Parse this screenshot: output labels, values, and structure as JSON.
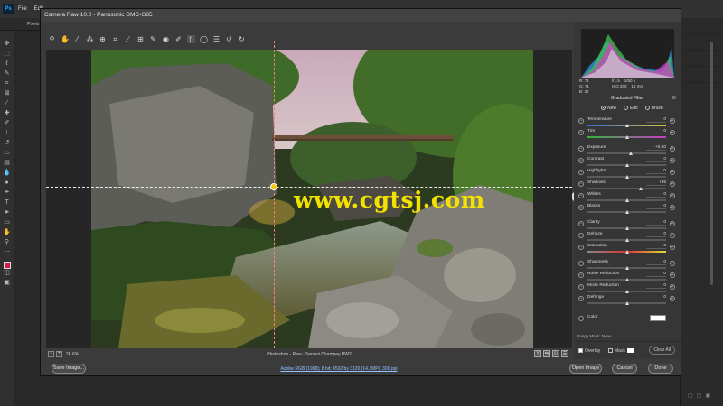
{
  "ps": {
    "logo": "Ps",
    "menu": [
      "File",
      "Edit"
    ],
    "option_text": "Pixels"
  },
  "dialog": {
    "title": "Camera Raw 10.0  -  Panasonic DMC-G85",
    "zoom_level": "26.6%",
    "filename": "Photoshop - Raw - Sennut Champey.RW2",
    "workflow_link": "Adobe RGB (1998); 8 bit; 4592 by 3120 (14.3MP); 300 ppi",
    "buttons": {
      "save_image": "Save Image...",
      "open_image": "Open Image",
      "cancel": "Cancel",
      "done": "Done"
    }
  },
  "watermark": "www.cgtsj.com",
  "readout": {
    "r": "R:    71",
    "g": "G:    71",
    "b": "B:    32",
    "aperture": "f/1.5",
    "shutter": "1/50 s",
    "iso": "ISO 200",
    "focal": "12 mm"
  },
  "panel": {
    "title": "Graduated Filter",
    "modes": [
      "New",
      "Edit",
      "Brush"
    ],
    "selected_mode": "New",
    "sliders": [
      {
        "label": "Temperature",
        "value": "0",
        "position": 0.5,
        "track": "temp"
      },
      {
        "label": "Tint",
        "value": "0",
        "position": 0.5,
        "track": "tint"
      },
      {
        "label": "Exposure",
        "value": "+0.30",
        "position": 0.55,
        "track": "plain",
        "gap": true
      },
      {
        "label": "Contrast",
        "value": "0",
        "position": 0.5,
        "track": "plain"
      },
      {
        "label": "Highlights",
        "value": "0",
        "position": 0.5,
        "track": "plain"
      },
      {
        "label": "Shadows",
        "value": "+35",
        "position": 0.68,
        "track": "plain"
      },
      {
        "label": "Whites",
        "value": "0",
        "position": 0.5,
        "track": "plain"
      },
      {
        "label": "Blacks",
        "value": "0",
        "position": 0.5,
        "track": "plain"
      },
      {
        "label": "Clarity",
        "value": "0",
        "position": 0.5,
        "track": "plain",
        "gap": true
      },
      {
        "label": "Dehaze",
        "value": "0",
        "position": 0.5,
        "track": "plain"
      },
      {
        "label": "Saturation",
        "value": "0",
        "position": 0.5,
        "track": "sat"
      },
      {
        "label": "Sharpness",
        "value": "0",
        "position": 0.5,
        "track": "plain",
        "gap": true
      },
      {
        "label": "Noise Reduction",
        "value": "0",
        "position": 0.5,
        "track": "plain"
      },
      {
        "label": "Moire Reduction",
        "value": "0",
        "position": 0.5,
        "track": "plain"
      },
      {
        "label": "Defringe",
        "value": "0",
        "position": 0.5,
        "track": "plain"
      }
    ],
    "color_label": "Color",
    "range_mask_label": "Range Mask:  None",
    "overlay_label": "Overlay",
    "mask_label": "Mask",
    "clear_all": "Clear All"
  }
}
